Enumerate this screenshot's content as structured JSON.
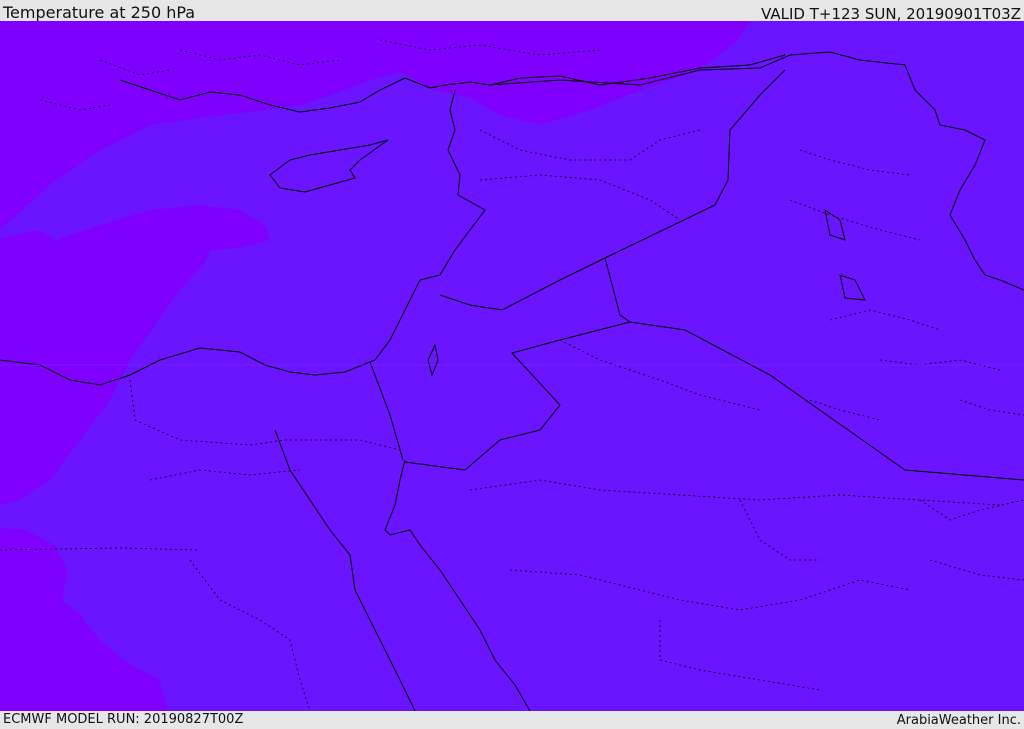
{
  "header": {
    "title": "Temperature at 250 hPa",
    "valid": "VALID T+123 SUN, 20190901T03Z"
  },
  "footer": {
    "model_run": "ECMWF MODEL RUN: 20190827T00Z",
    "credit": "ArabiaWeather Inc."
  },
  "map": {
    "fields": [
      {
        "name": "warmer-band",
        "color": "#8000ff"
      },
      {
        "name": "cooler-band",
        "color": "#6a14ff"
      }
    ],
    "border_color": "#000000"
  }
}
